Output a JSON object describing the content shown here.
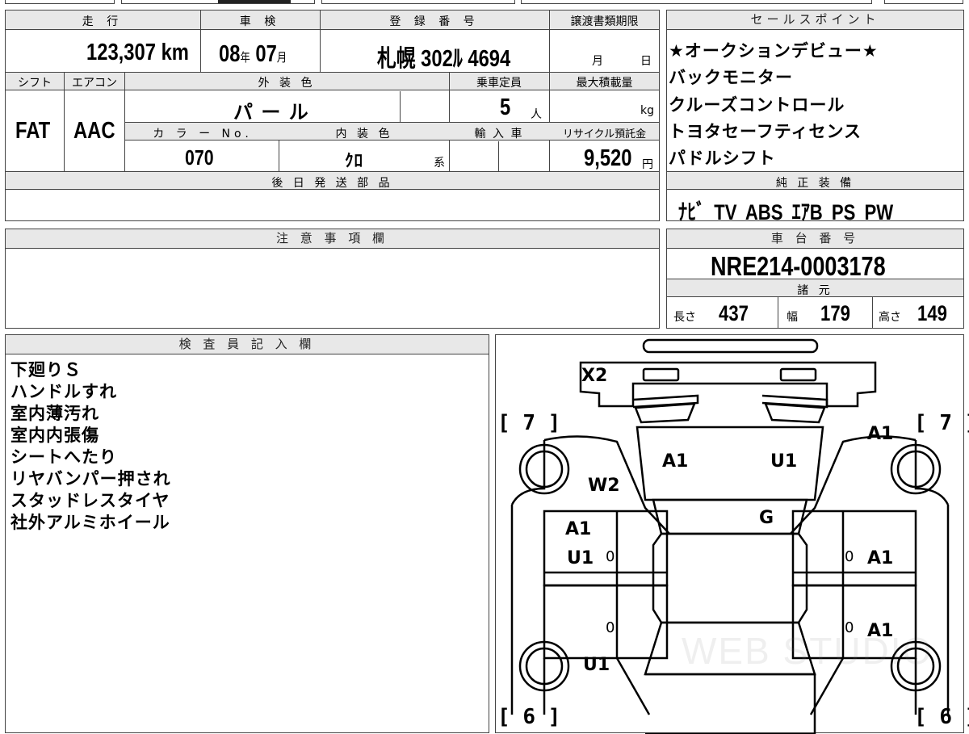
{
  "summary": {
    "mileage_label": "走 行",
    "mileage_value": "123,307",
    "mileage_unit": "km",
    "inspection_label": "車 検",
    "inspection_year": "08",
    "inspection_year_unit": "年",
    "inspection_month": "07",
    "inspection_month_unit": "月",
    "registration_label": "登 録 番 号",
    "registration_value": "札幌 302ﾙ 4694",
    "transfer_deadline_label": "譲渡書類期限",
    "transfer_month_unit": "月",
    "transfer_day_unit": "日"
  },
  "specs": {
    "shift_label": "シフト",
    "shift_value": "FAT",
    "aircon_label": "エアコン",
    "aircon_value": "AAC",
    "exterior_color_label": "外 装 色",
    "exterior_color_value": "パ ー ル",
    "capacity_label": "乗車定員",
    "capacity_value": "5",
    "capacity_unit": "人",
    "max_load_label": "最大積載量",
    "max_load_unit": "kg",
    "color_no_label": "カ ラ ー No.",
    "color_no_value": "070",
    "interior_color_label": "内 装 色",
    "interior_color_value": "ｸﾛ",
    "interior_color_suffix": "系",
    "import_label": "輸 入 車",
    "recycle_label": "リサイクル預託金",
    "recycle_value": "9,520",
    "recycle_unit": "円"
  },
  "deferred_parts": {
    "label": "後 日 発 送 部 品"
  },
  "notes": {
    "label": "注 意 事 項 欄"
  },
  "selling_points": {
    "label": "セールスポイント",
    "items": [
      "★オークションデビュー★",
      "バックモニター",
      "クルーズコントロール",
      "トヨタセーフティセンス",
      "パドルシフト"
    ]
  },
  "equipment": {
    "label": "純 正 装 備",
    "value": "ﾅﾋﾞ TV ABS ｴｱB PS PW"
  },
  "chassis": {
    "label": "車 台 番 号",
    "value": "NRE214-0003178"
  },
  "dimensions": {
    "label": "諸 元",
    "length_label": "長さ",
    "length_value": "437",
    "width_label": "幅",
    "width_value": "179",
    "height_label": "高さ",
    "height_value": "149"
  },
  "inspector": {
    "label": "検 査 員 記 入 欄",
    "lines": [
      "下廻りＳ",
      "ハンドルすれ",
      "室内薄汚れ",
      "室内内張傷",
      "シートへたり",
      "リヤバンパー押され",
      "スタッドレスタイヤ",
      "社外アルミホイール"
    ]
  },
  "diagram": {
    "tire_fl": "7",
    "tire_fr": "7",
    "tire_rl": "6",
    "tire_rr": "6",
    "marks": {
      "rear_bumper": "X2",
      "rear_glass_left": "A1",
      "rear_glass_right": "U1",
      "left_rear_fender": "W2",
      "right_rear_fender": "A1",
      "roof_glass": "G",
      "left_rear_door_1": "A1",
      "left_rear_door_2": "U1",
      "right_rear_door": "A1",
      "right_front_door": "A1",
      "left_front_fender": "U1"
    },
    "zero_mark": "0",
    "watermark": "WEB STUDIO"
  }
}
